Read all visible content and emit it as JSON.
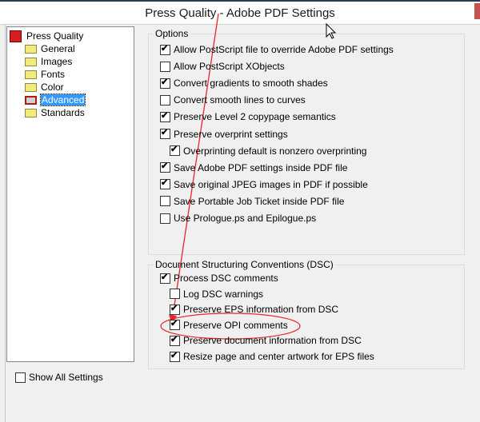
{
  "window": {
    "title": "Press Quality - Adobe PDF Settings"
  },
  "tree": {
    "root": "Press Quality",
    "items": [
      {
        "label": "General",
        "selected": false
      },
      {
        "label": "Images",
        "selected": false
      },
      {
        "label": "Fonts",
        "selected": false
      },
      {
        "label": "Color",
        "selected": false
      },
      {
        "label": "Advanced",
        "selected": true
      },
      {
        "label": "Standards",
        "selected": false
      }
    ]
  },
  "options": {
    "label": "Options",
    "items": [
      {
        "label": "Allow PostScript file to override Adobe PDF settings",
        "checked": true
      },
      {
        "label": "Allow PostScript XObjects",
        "checked": false
      },
      {
        "label": "Convert gradients to smooth shades",
        "checked": true
      },
      {
        "label": "Convert smooth lines to curves",
        "checked": false
      },
      {
        "label": "Preserve Level 2 copypage semantics",
        "checked": true
      },
      {
        "label": "Preserve overprint settings",
        "checked": true
      },
      {
        "label": "Overprinting default is nonzero overprinting",
        "checked": true,
        "indent": true
      },
      {
        "label": "Save Adobe PDF settings inside PDF file",
        "checked": true
      },
      {
        "label": "Save original JPEG images in PDF if possible",
        "checked": true
      },
      {
        "label": "Save Portable Job Ticket inside PDF file",
        "checked": false
      },
      {
        "label": "Use Prologue.ps and Epilogue.ps",
        "checked": false
      }
    ]
  },
  "dsc": {
    "label": "Document Structuring Conventions (DSC)",
    "items": [
      {
        "label": "Process DSC comments",
        "checked": true
      },
      {
        "label": "Log DSC warnings",
        "checked": false,
        "indent": true
      },
      {
        "label": "Preserve EPS information from DSC",
        "checked": true,
        "indent": true
      },
      {
        "label": "Preserve OPI comments",
        "checked": true,
        "indent": true
      },
      {
        "label": "Preserve document information from DSC",
        "checked": true,
        "indent": true
      },
      {
        "label": "Resize page and center artwork for EPS files",
        "checked": true,
        "indent": true
      }
    ]
  },
  "show_all": {
    "label": "Show All Settings",
    "checked": false
  },
  "colors": {
    "annotation": "#e8262b",
    "selection": "#3399ff"
  }
}
